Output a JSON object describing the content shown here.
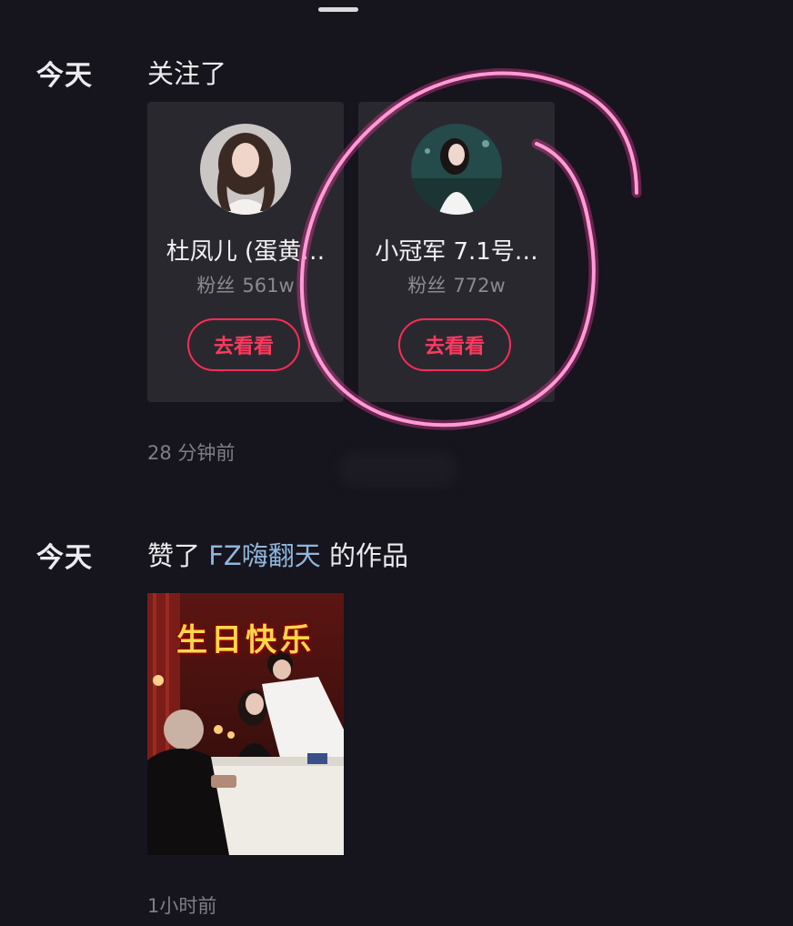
{
  "activity": [
    {
      "day": "今天",
      "action": "关注了",
      "time": "28 分钟前",
      "cards": [
        {
          "name": "杜凤儿 (蛋黄…",
          "fans_label": "粉丝",
          "fans_count": "561w",
          "button": "去看看"
        },
        {
          "name": "小冠军 7.1号…",
          "fans_label": "粉丝",
          "fans_count": "772w",
          "button": "去看看"
        }
      ]
    },
    {
      "day": "今天",
      "action_prefix": "赞了",
      "action_user": "FZ嗨翻天",
      "action_suffix": "的作品",
      "thumbnail_caption": "生日快乐",
      "time": "1小时前"
    }
  ],
  "colors": {
    "background": "#16141d",
    "card": "#2a282f",
    "accent": "#fe2c55",
    "link": "#8fb6dc",
    "annotation": "#ff3fa8"
  }
}
